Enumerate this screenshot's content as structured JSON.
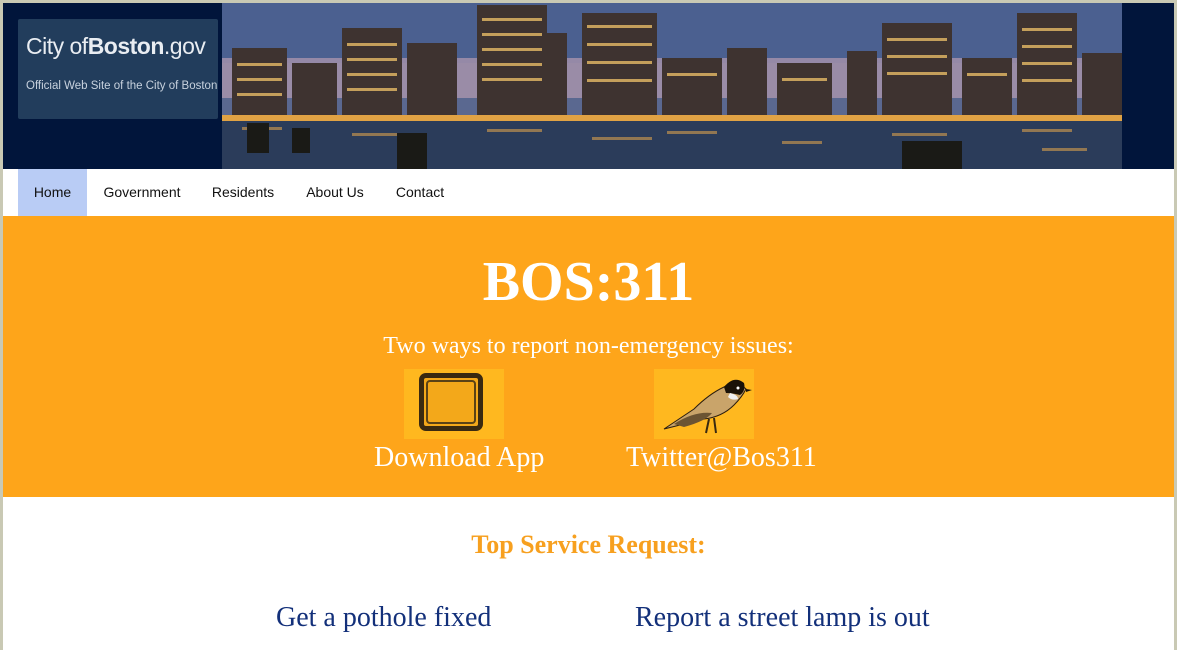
{
  "logo": {
    "city": "City of",
    "name": "Boston",
    "tld": ".gov",
    "tagline": "Official Web Site of the City of Boston"
  },
  "nav": {
    "items": [
      {
        "label": "Home",
        "active": true
      },
      {
        "label": "Government",
        "active": false
      },
      {
        "label": "Residents",
        "active": false
      },
      {
        "label": "About Us",
        "active": false
      },
      {
        "label": "Contact",
        "active": false
      }
    ]
  },
  "hero": {
    "title": "BOS:311",
    "subtitle": "Two ways to report non-emergency issues:",
    "options": [
      {
        "label": "Download App",
        "icon": "tablet-icon"
      },
      {
        "label": "Twitter@Bos311",
        "icon": "bird-icon"
      }
    ]
  },
  "services": {
    "title": "Top Service Request:",
    "items": [
      {
        "label": "Get a pothole fixed"
      },
      {
        "label": "Report a street lamp is out"
      }
    ]
  },
  "colors": {
    "header_bg": "#01153b",
    "hero_bg": "#fea51a",
    "nav_active": "#b9ccf5",
    "section_title": "#f7a01f",
    "service_link": "#13307a"
  }
}
